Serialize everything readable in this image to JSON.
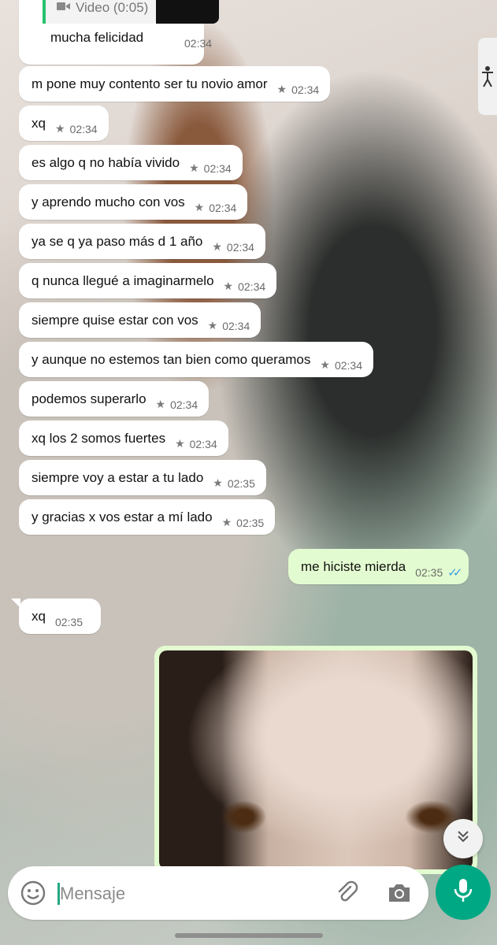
{
  "top_message": {
    "video_label": "Video (0:05)",
    "text": "mucha felicidad",
    "time": "02:34"
  },
  "messages": [
    {
      "text": "m pone muy contento ser tu novio amor",
      "time": "02:34",
      "starred": true
    },
    {
      "text": "xq",
      "time": "02:34",
      "starred": true
    },
    {
      "text": "es algo q no había vivido",
      "time": "02:34",
      "starred": true
    },
    {
      "text": "y aprendo mucho con vos",
      "time": "02:34",
      "starred": true
    },
    {
      "text": "ya se q ya paso más d 1 año",
      "time": "02:34",
      "starred": true
    },
    {
      "text": "q nunca llegué a imaginarmelo",
      "time": "02:34",
      "starred": true
    },
    {
      "text": "siempre quise estar con vos",
      "time": "02:34",
      "starred": true
    },
    {
      "text": "y aunque no estemos tan bien como queramos",
      "time": "02:34",
      "starred": true
    },
    {
      "text": "podemos superarlo",
      "time": "02:34",
      "starred": true
    },
    {
      "text": "xq los 2 somos fuertes",
      "time": "02:34",
      "starred": true
    },
    {
      "text": "siempre voy a estar a tu lado",
      "time": "02:35",
      "starred": true
    },
    {
      "text": "y gracias x vos estar a mí lado",
      "time": "02:35",
      "starred": true
    }
  ],
  "outgoing": {
    "text": "me hiciste mierda",
    "time": "02:35",
    "status": "read"
  },
  "incoming_last": {
    "text": "xq",
    "time": "02:35"
  },
  "input": {
    "placeholder": "Mensaje"
  },
  "colors": {
    "accent": "#00a884",
    "outgoing_bubble": "#e3fbd0",
    "read_ticks": "#3aa0e6"
  }
}
